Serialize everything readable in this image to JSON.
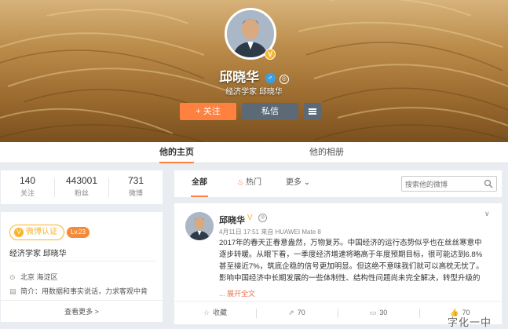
{
  "profile": {
    "name": "邱晓华",
    "bio": "经济学家 邱晓华",
    "follow_label": "+ 关注",
    "message_label": "私信"
  },
  "tabs": {
    "home": "他的主页",
    "album": "他的相册"
  },
  "stats": [
    {
      "value": "140",
      "label": "关注"
    },
    {
      "value": "443001",
      "label": "粉丝"
    },
    {
      "value": "731",
      "label": "微博"
    }
  ],
  "info": {
    "verify_label": "微博认证",
    "level": "Lv.23",
    "bio": "经济学家 邱晓华",
    "location": "北京 海淀区",
    "intro": "简介：用数据和事实说话，力求客观中肯",
    "see_more": "查看更多 >"
  },
  "feed_filters": {
    "all": "全部",
    "hot": "热门",
    "more": "更多",
    "search_placeholder": "搜索他的微博"
  },
  "post": {
    "author": "邱晓华",
    "meta": "4月11日 17:51 来自 HUAWEI Mate 8",
    "lines": [
      "2017年的春天正春意盎然，万物复苏。中国经济的运行态势似乎也在丝丝寒意中",
      "逐步转暖。从眼下看，一季度经济增速将略高于年度预期目标，很可能达到6.8%",
      "甚至接近7%，筑底企稳的信号更加明显。但这绝不意味我们就可以高枕无忧了。",
      "影响中国经济中长期发展的一些体制性、结构性问题尚未完全解决，转型升级的"
    ],
    "expand": "... 展开全文",
    "actions": [
      {
        "icon": "star-icon",
        "label": "收藏"
      },
      {
        "icon": "share-icon",
        "label": "70"
      },
      {
        "icon": "comment-icon",
        "label": "30"
      },
      {
        "icon": "thumbs-up-icon",
        "label": "70"
      }
    ]
  },
  "watermark": "字化一中"
}
